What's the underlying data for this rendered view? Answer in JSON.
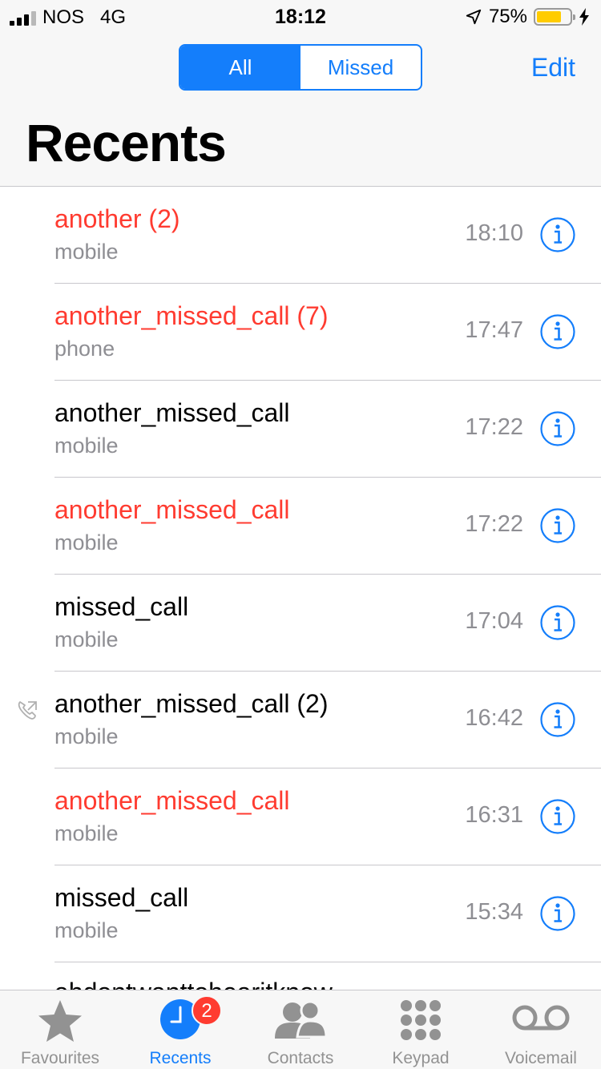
{
  "status_bar": {
    "carrier": "NOS",
    "network": "4G",
    "time": "18:12",
    "battery_percent": "75%",
    "battery_level": 0.75
  },
  "segmented": {
    "all_label": "All",
    "missed_label": "Missed",
    "selected": "All"
  },
  "header": {
    "edit_label": "Edit",
    "title": "Recents"
  },
  "calls": [
    {
      "name": "another (2)",
      "type": "mobile",
      "time": "18:10",
      "missed": true,
      "outgoing": false
    },
    {
      "name": "another_missed_call (7)",
      "type": "phone",
      "time": "17:47",
      "missed": true,
      "outgoing": false
    },
    {
      "name": "another_missed_call",
      "type": "mobile",
      "time": "17:22",
      "missed": false,
      "outgoing": false
    },
    {
      "name": "another_missed_call",
      "type": "mobile",
      "time": "17:22",
      "missed": true,
      "outgoing": false
    },
    {
      "name": "missed_call",
      "type": "mobile",
      "time": "17:04",
      "missed": false,
      "outgoing": false
    },
    {
      "name": "another_missed_call (2)",
      "type": "mobile",
      "time": "16:42",
      "missed": false,
      "outgoing": true
    },
    {
      "name": "another_missed_call",
      "type": "mobile",
      "time": "16:31",
      "missed": true,
      "outgoing": false
    },
    {
      "name": "missed_call",
      "type": "mobile",
      "time": "15:34",
      "missed": false,
      "outgoing": false
    }
  ],
  "partial_row_name": "ahdontwanttohearitknow",
  "tabs": [
    {
      "label": "Favourites",
      "icon": "star-icon"
    },
    {
      "label": "Recents",
      "icon": "clock-icon",
      "badge": "2"
    },
    {
      "label": "Contacts",
      "icon": "contacts-icon"
    },
    {
      "label": "Keypad",
      "icon": "keypad-icon"
    },
    {
      "label": "Voicemail",
      "icon": "voicemail-icon"
    }
  ],
  "colors": {
    "accent": "#147efb",
    "missed": "#ff3b30",
    "secondary_text": "#8e8e93",
    "bar_background": "#f7f7f7",
    "battery_fill": "#ffcc00"
  }
}
